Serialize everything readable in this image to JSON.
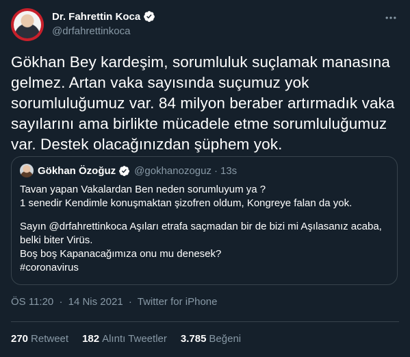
{
  "author": {
    "display_name": "Dr. Fahrettin Koca",
    "handle": "@drfahrettinkoca",
    "verified": true
  },
  "tweet": {
    "lines": [
      "Gökhan Bey kardeşim, sorumluluk suçlamak manasına",
      "gelmez. Artan vaka sayısında suçumuz yok",
      "sorumluluğumuz var. 84 milyon beraber artırmadık vaka",
      "sayılarını ama birlikte mücadele etme sorumluluğumuz",
      "var. Destek olacağınızdan şüphem yok."
    ]
  },
  "quoted": {
    "display_name": "Gökhan Özoğuz",
    "handle": "@gokhanozoguz",
    "dot": "·",
    "time": "13s",
    "verified": true,
    "lines_block1": [
      "Tavan yapan Vakalardan Ben neden sorumluyum ya ?",
      "1 senedir Kendimle konuşmaktan şizofren oldum, Kongreye falan da yok."
    ],
    "lines_block2": [
      "Sayın @drfahrettinkoca Aşıları etrafa saçmadan bir de bizi mi Aşılasanız acaba,",
      "belki biter Virüs.",
      "Boş boş Kapanacağımıza onu mu denesek?",
      "#coronavirus"
    ]
  },
  "meta": {
    "time": "ÖS 11:20",
    "sep": "·",
    "date": "14 Nis 2021",
    "source": "Twitter for iPhone"
  },
  "stats": {
    "retweets": {
      "count": "270",
      "label": "Retweet"
    },
    "quotes": {
      "count": "182",
      "label": "Alıntı Tweetler"
    },
    "likes": {
      "count": "3.785",
      "label": "Beğeni"
    }
  },
  "colors": {
    "background": "#15202b",
    "text_primary": "#ffffff",
    "text_secondary": "#8899a6",
    "border": "#38444d",
    "verified_badge": "#ffffff"
  },
  "icons": {
    "verified": "verified-badge-icon",
    "more": "more-options-icon"
  }
}
